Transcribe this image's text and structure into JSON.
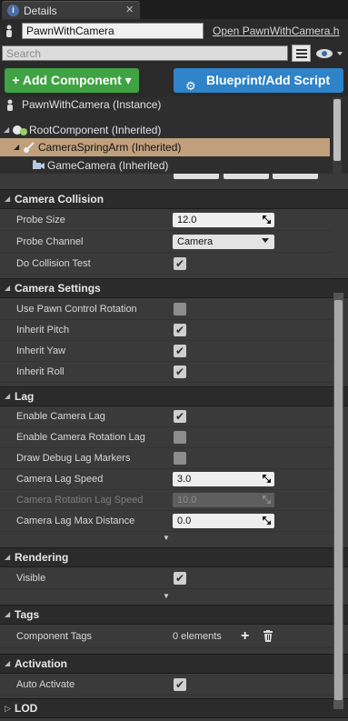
{
  "tab": {
    "icon": "i",
    "title": "Details"
  },
  "header": {
    "actor_name": "PawnWithCamera",
    "open_link": "Open PawnWithCamera.h"
  },
  "search": {
    "placeholder": "Search"
  },
  "buttons": {
    "add_component": "+ Add Component ▾",
    "blueprint": "Blueprint/Add Script"
  },
  "tree": {
    "instance": "PawnWithCamera (Instance)",
    "items": [
      {
        "label": "RootComponent (Inherited)"
      },
      {
        "label": "CameraSpringArm (Inherited)"
      },
      {
        "label": "GameCamera (Inherited)"
      }
    ]
  },
  "sections": {
    "collision": {
      "title": "Camera Collision",
      "probe_size_label": "Probe Size",
      "probe_size_value": "12.0",
      "probe_channel_label": "Probe Channel",
      "probe_channel_value": "Camera",
      "do_collision_label": "Do Collision Test",
      "do_collision_checked": true
    },
    "settings": {
      "title": "Camera Settings",
      "pawn_rot_label": "Use Pawn Control Rotation",
      "pawn_rot_checked": false,
      "pitch_label": "Inherit Pitch",
      "pitch_checked": true,
      "yaw_label": "Inherit Yaw",
      "yaw_checked": true,
      "roll_label": "Inherit Roll",
      "roll_checked": true
    },
    "lag": {
      "title": "Lag",
      "enable_lag_label": "Enable Camera Lag",
      "enable_lag_checked": true,
      "enable_rot_lag_label": "Enable Camera Rotation Lag",
      "enable_rot_lag_checked": false,
      "debug_label": "Draw Debug Lag Markers",
      "debug_checked": false,
      "lag_speed_label": "Camera Lag Speed",
      "lag_speed_value": "3.0",
      "rot_lag_speed_label": "Camera Rotation Lag Speed",
      "rot_lag_speed_value": "10.0",
      "max_dist_label": "Camera Lag Max Distance",
      "max_dist_value": "0.0"
    },
    "rendering": {
      "title": "Rendering",
      "visible_label": "Visible",
      "visible_checked": true
    },
    "tags": {
      "title": "Tags",
      "component_tags_label": "Component Tags",
      "component_tags_value": "0 elements"
    },
    "activation": {
      "title": "Activation",
      "auto_activate_label": "Auto Activate",
      "auto_activate_checked": true
    },
    "lod": {
      "title": "LOD"
    }
  },
  "icons": {
    "tab": "details-icon",
    "close": "close-icon",
    "pawn": "pawn-icon",
    "grid": "grid-view-icon",
    "eye": "eye-icon",
    "gear": "gear-icon",
    "root": "scene-component-icon",
    "spring": "spring-arm-icon",
    "camera": "camera-icon",
    "reset": "reset-arrow-icon",
    "plus": "add-icon",
    "trash": "trash-icon",
    "expand": "expand-arrow-icon"
  },
  "colors": {
    "add_button": "#3fa343",
    "blueprint_button": "#2f83c8",
    "selected_row": "#c0a07c"
  }
}
